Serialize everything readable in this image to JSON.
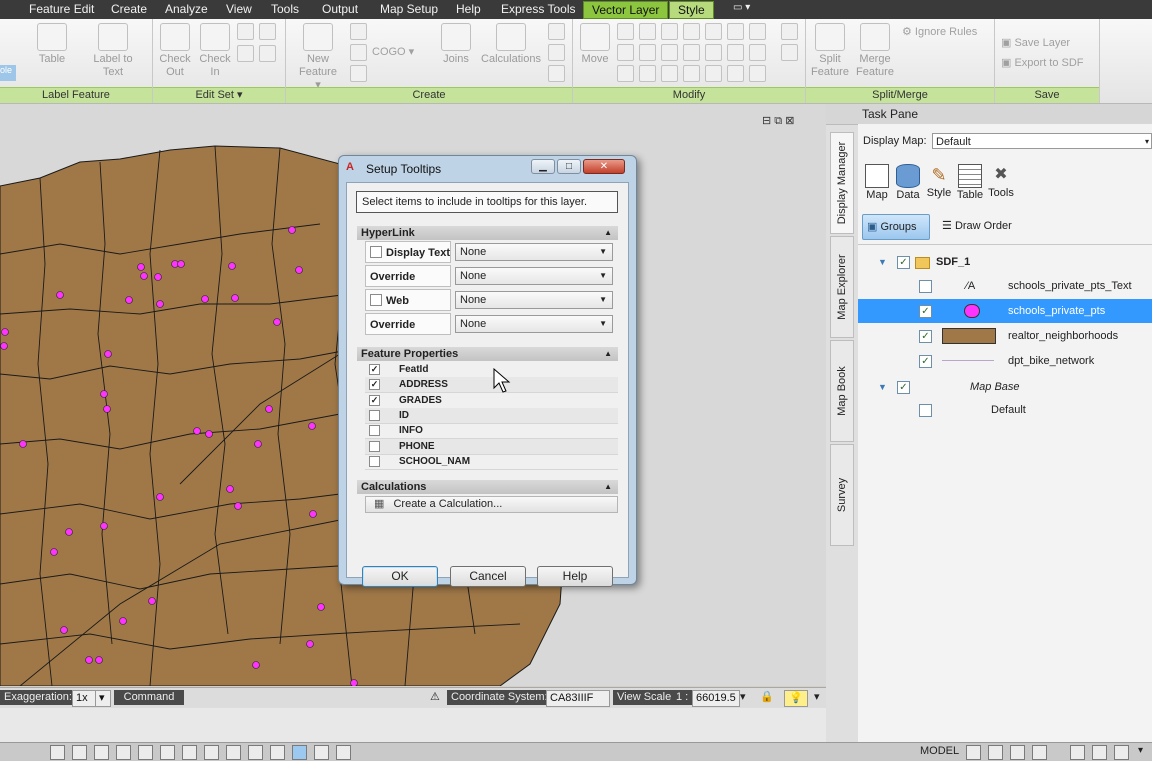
{
  "menubar": {
    "items": [
      "Feature Edit",
      "Create",
      "Analyze",
      "View",
      "Tools",
      "Output",
      "Map Setup",
      "Help",
      "Express Tools"
    ],
    "context_tabs": [
      "Vector Layer",
      "Style"
    ]
  },
  "ribbon": {
    "panels": {
      "label_feature": "Label Feature",
      "edit_set": "Edit Set",
      "create": "Create",
      "modify": "Modify",
      "split_merge": "Split/Merge",
      "save": "Save"
    },
    "buttons": {
      "table": "Table",
      "label_to_text": "Label to Text",
      "check_out": "Check Out",
      "check_in": "Check In",
      "new_feature": "New Feature",
      "cogo": "COGO",
      "joins": "Joins",
      "calculations": "Calculations",
      "move": "Move",
      "split_feature": "Split Feature",
      "merge_feature": "Merge Feature",
      "ignore_rules": "Ignore Rules",
      "save_layer": "Save Layer",
      "export_to_sdf": "Export to SDF"
    }
  },
  "statusbar": {
    "exaggeration_label": "Exaggeration:",
    "exaggeration_value": "1x",
    "command": "Command",
    "coord_label": "Coordinate System:",
    "coord_value": "CA83IIIF",
    "scale_label": "View Scale",
    "scale_prefix": "1 :",
    "scale_value": "66019.5"
  },
  "bottombar": {
    "model": "MODEL"
  },
  "taskpane": {
    "title": "Task Pane",
    "vertical_tabs": [
      "Display Manager",
      "Map Explorer",
      "Map Book",
      "Survey"
    ],
    "display_map_label": "Display Map:",
    "display_map_value": "Default",
    "tools": [
      "Map",
      "Data",
      "Style",
      "Table",
      "Tools"
    ],
    "groups_btn": "Groups",
    "draw_order_btn": "Draw Order",
    "tree": {
      "group": "SDF_1",
      "layers": [
        "schools_private_pts_Text",
        "schools_private_pts",
        "realtor_neighborhoods",
        "dpt_bike_network"
      ],
      "map_base": "Map Base",
      "default": "Default"
    },
    "colors": {
      "selected_row": "#3399ff",
      "schools": "#ff33ff",
      "neighborhoods": "#a07848"
    }
  },
  "dialog": {
    "title": "Setup Tooltips",
    "instructions": "Select items to include in tooltips for this layer.",
    "hyperlink_section": "HyperLink",
    "display_text": "Display Text",
    "override": "Override",
    "web_address": "Web Address",
    "none": "None",
    "feature_props_section": "Feature Properties",
    "properties": [
      {
        "name": "FeatId",
        "checked": true
      },
      {
        "name": "ADDRESS",
        "checked": true
      },
      {
        "name": "GRADES",
        "checked": true
      },
      {
        "name": "ID",
        "checked": false
      },
      {
        "name": "INFO",
        "checked": false
      },
      {
        "name": "PHONE",
        "checked": false
      },
      {
        "name": "SCHOOL_NAM",
        "checked": false
      }
    ],
    "calculations_section": "Calculations",
    "create_calc": "Create a Calculation...",
    "ok": "OK",
    "cancel": "Cancel",
    "help": "Help"
  }
}
